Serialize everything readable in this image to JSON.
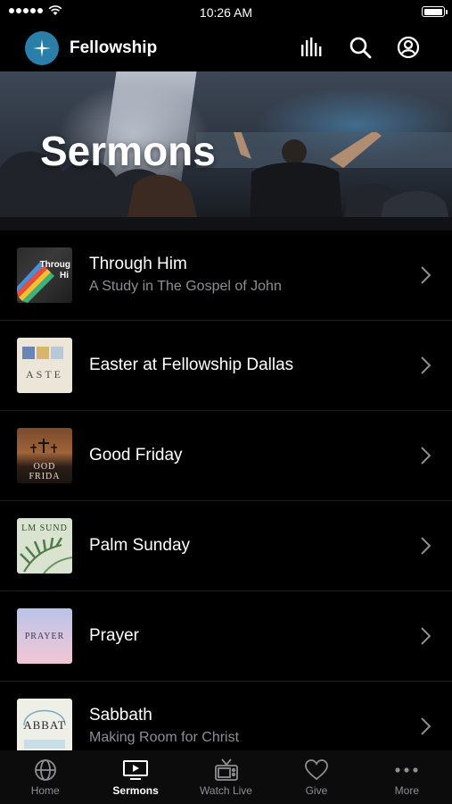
{
  "status_bar": {
    "time": "10:26 AM"
  },
  "header": {
    "app_title": "Fellowship"
  },
  "hero": {
    "title": "Sermons"
  },
  "sermons": [
    {
      "title": "Through Him",
      "subtitle": "A Study in The Gospel of John",
      "thumb_text": "Throug\nHi"
    },
    {
      "title": "Easter at Fellowship Dallas",
      "subtitle": "",
      "thumb_text": "ASTE"
    },
    {
      "title": "Good Friday",
      "subtitle": "",
      "thumb_text": "OOD FRIDA"
    },
    {
      "title": "Palm Sunday",
      "subtitle": "",
      "thumb_text": "LM SUND"
    },
    {
      "title": "Prayer",
      "subtitle": "",
      "thumb_text": "PRAYER"
    },
    {
      "title": "Sabbath",
      "subtitle": "Making Room for Christ",
      "thumb_text": "ABBAT"
    }
  ],
  "tabs": [
    {
      "label": "Home",
      "icon": "globe-icon"
    },
    {
      "label": "Sermons",
      "icon": "tv-icon",
      "active": true
    },
    {
      "label": "Watch Live",
      "icon": "retro-tv-icon"
    },
    {
      "label": "Give",
      "icon": "heart-icon"
    },
    {
      "label": "More",
      "icon": "more-dots-icon"
    }
  ],
  "colors": {
    "brand": "#2a7fa8",
    "background": "#000000",
    "secondary_text": "#8e8e93"
  }
}
